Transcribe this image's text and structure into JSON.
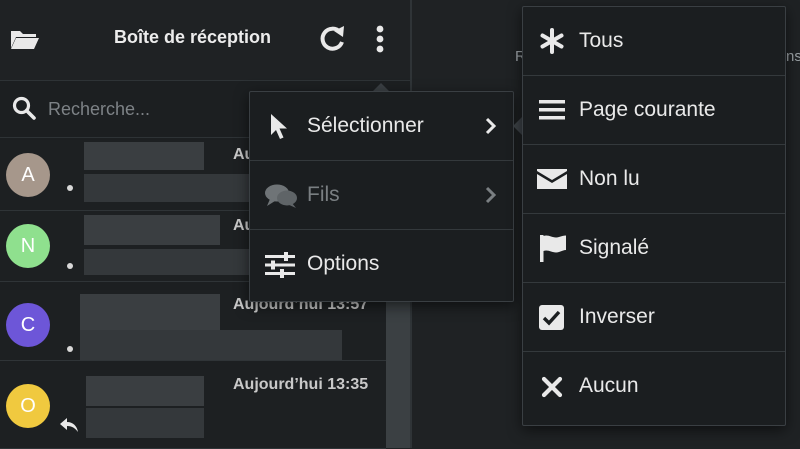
{
  "header": {
    "title": "Boîte de réception",
    "icons": [
      "folder-icon",
      "refresh-icon",
      "more-vertical-icon"
    ]
  },
  "search": {
    "placeholder": "Recherche..."
  },
  "messages": [
    {
      "avatar_letter": "A",
      "avatar_color": "#a6978b",
      "date": "Au"
    },
    {
      "avatar_letter": "N",
      "avatar_color": "#8fe08e",
      "date": "Au"
    },
    {
      "avatar_letter": "C",
      "avatar_color": "#6d56d8",
      "date": "Aujourd’hui 13:57"
    },
    {
      "avatar_letter": "O",
      "avatar_color": "#f0c93f",
      "date": "Aujourd’hui 13:35",
      "replied": true
    }
  ],
  "preview": {
    "left_fragment": "R",
    "right_fragment": "ns"
  },
  "menu_main": {
    "items": [
      {
        "label": "Sélectionner",
        "icon": "pointer-icon",
        "has_submenu": true,
        "enabled": true
      },
      {
        "label": "Fils",
        "icon": "threads-icon",
        "has_submenu": true,
        "enabled": false
      },
      {
        "label": "Options",
        "icon": "sliders-icon",
        "has_submenu": false,
        "enabled": true
      }
    ]
  },
  "menu_select": {
    "items": [
      {
        "label": "Tous",
        "icon": "asterisk-icon"
      },
      {
        "label": "Page courante",
        "icon": "list-icon"
      },
      {
        "label": "Non lu",
        "icon": "envelope-icon"
      },
      {
        "label": "Signalé",
        "icon": "flag-icon"
      },
      {
        "label": "Inverser",
        "icon": "checkbox-icon"
      },
      {
        "label": "Aucun",
        "icon": "close-icon"
      }
    ]
  },
  "colors": {
    "background": "#1f2224",
    "menu_bg": "#1b1e20",
    "text": "#e9e9e9",
    "disabled": "#7a7f82"
  }
}
